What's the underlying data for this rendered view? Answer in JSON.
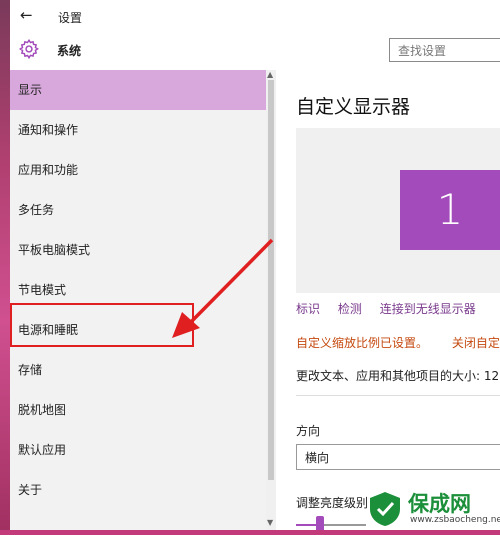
{
  "window": {
    "title": "设置"
  },
  "header": {
    "section_label": "系统",
    "search_placeholder": "查找设置"
  },
  "sidebar": {
    "items": [
      {
        "label": "显示",
        "active": true
      },
      {
        "label": "通知和操作"
      },
      {
        "label": "应用和功能"
      },
      {
        "label": "多任务"
      },
      {
        "label": "平板电脑模式"
      },
      {
        "label": "节电模式"
      },
      {
        "label": "电源和睡眠",
        "highlighted": true
      },
      {
        "label": "存储"
      },
      {
        "label": "脱机地图"
      },
      {
        "label": "默认应用"
      },
      {
        "label": "关于"
      }
    ]
  },
  "main": {
    "heading": "自定义显示器",
    "monitor_number": "1",
    "links": {
      "identify": "标识",
      "detect": "检测",
      "connect": "连接到无线显示器"
    },
    "notice": "自定义缩放比例已设置。",
    "notice_action": "关闭自定",
    "size_text": "更改文本、应用和其他项目的大小: 12",
    "orientation_label": "方向",
    "orientation_value": "横向",
    "brightness_label": "调整亮度级别",
    "brightness_level": 0.3
  },
  "watermark": {
    "title": "保成网",
    "url": "www.zsbaocheng.net"
  },
  "colors": {
    "accent": "#a34bbb",
    "active_item": "#d8a8dc",
    "annotation": "#e02020",
    "notice": "#c54a10"
  },
  "icons": {
    "back": "back-arrow-icon",
    "system": "gear-icon"
  }
}
